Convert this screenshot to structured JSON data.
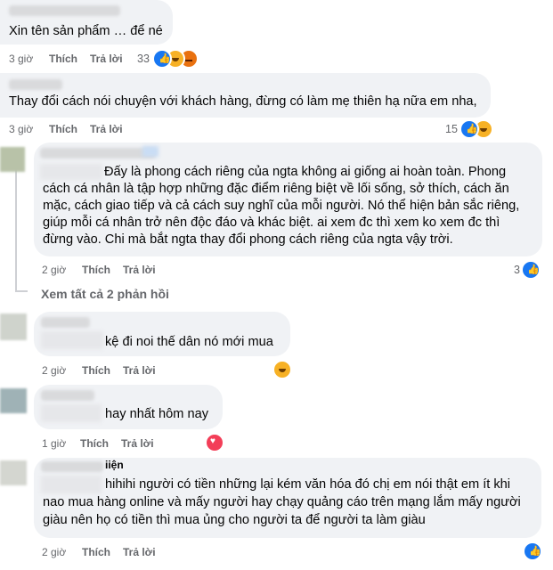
{
  "comments": [
    {
      "text": "Xin tên sản phẩm … để né",
      "time": "3 giờ",
      "like": "Thích",
      "reply": "Trả lời",
      "count": "33"
    },
    {
      "text": "Thay đổi cách nói chuyện với khách hàng, đừng có làm mẹ thiên hạ nữa em nha,",
      "time": "3 giờ",
      "like": "Thích",
      "reply": "Trả lời",
      "count": "15"
    },
    {
      "lines": [
        "Đấy là phong cách riêng của ngta không ai giống ai hoàn toàn. Phong",
        "cách cá nhân là tập hợp những đặc điểm riêng biệt về lối sống, sở thích, cách ăn",
        "mặc, cách giao tiếp và cả cách suy nghĩ của mỗi người. Nó thể hiện bản sắc riêng,",
        "giúp mỗi cá nhân trở nên độc đáo và khác biệt. ai xem đc thì xem ko xem đc thì",
        "đừng vào. Chi mà bắt ngta thay đổi phong cách riêng của ngta vậy trời."
      ],
      "time": "2 giờ",
      "like": "Thích",
      "reply": "Trả lời",
      "count": "3"
    },
    {
      "text": "kệ đi noi thế dân nó mới mua",
      "time": "2 giờ",
      "like": "Thích",
      "reply": "Trả lời"
    },
    {
      "text": "hay nhất hôm nay",
      "time": "1 giờ",
      "like": "Thích",
      "reply": "Trả lời"
    },
    {
      "lines": [
        "hihihi người có tiền những lại kém văn hóa đó chị em nói thật em ít khi",
        "nao mua hàng online và mấy người hay chạy quảng cáo trên mạng lắm mấy người",
        "giàu nên họ có tiền thì mua ủng cho người ta để người ta làm giàu"
      ],
      "time": "2 giờ",
      "like": "Thích",
      "reply": "Trả lời"
    }
  ],
  "see_replies": "Xem tất cả 2 phản hồi",
  "partial_name": "iiện",
  "icons": {
    "like": "like-reaction-icon",
    "haha": "haha-reaction-icon",
    "angry": "angry-reaction-icon",
    "love": "love-reaction-icon"
  },
  "colors": {
    "bubble": "#f0f2f5",
    "like": "#1877f2",
    "meta": "#65676b"
  }
}
